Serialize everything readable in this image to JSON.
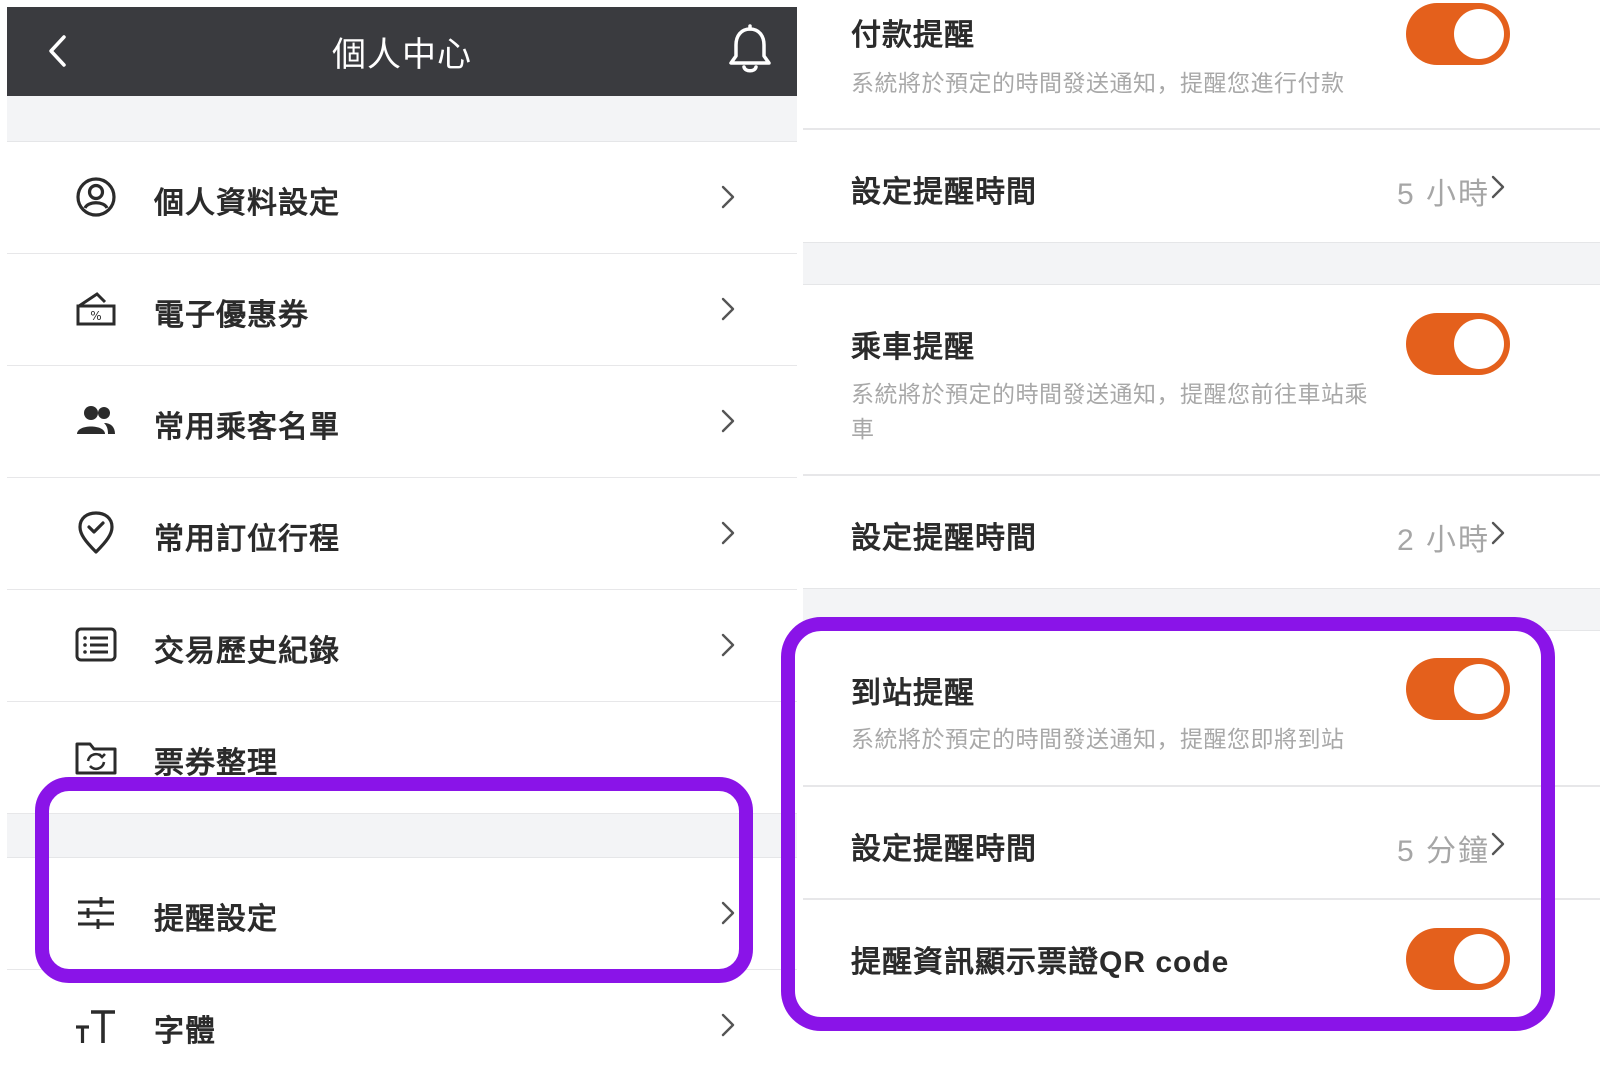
{
  "left_panel": {
    "header": {
      "title": "個人中心",
      "back_icon": "chevron-left-icon",
      "bell_icon": "bell-icon"
    },
    "menu_items": [
      {
        "label": "個人資料設定",
        "icon": "user-circle-icon"
      },
      {
        "label": "電子優惠券",
        "icon": "coupon-icon"
      },
      {
        "label": "常用乘客名單",
        "icon": "people-icon"
      },
      {
        "label": "常用訂位行程",
        "icon": "location-check-icon"
      },
      {
        "label": "交易歷史紀錄",
        "icon": "list-icon"
      },
      {
        "label": "票券整理",
        "icon": "folder-sync-icon"
      },
      {
        "label": "提醒設定",
        "icon": "sliders-icon"
      },
      {
        "label": "字體",
        "icon": "font-size-icon"
      }
    ]
  },
  "right_panel": {
    "payment_reminder": {
      "title": "付款提醒",
      "description": "系統將於預定的時間發送通知，提醒您進行付款",
      "enabled": true
    },
    "payment_time": {
      "label": "設定提醒時間",
      "value": "5 小時"
    },
    "boarding_reminder": {
      "title": "乘車提醒",
      "description": "系統將於預定的時間發送通知，提醒您前往車站乘車",
      "enabled": true
    },
    "boarding_time": {
      "label": "設定提醒時間",
      "value": "2 小時"
    },
    "arrival_reminder": {
      "title": "到站提醒",
      "description": "系統將於預定的時間發送通知，提醒您即將到站",
      "enabled": true
    },
    "arrival_time": {
      "label": "設定提醒時間",
      "value": "5 分鐘"
    },
    "qr_code_toggle": {
      "label": "提醒資訊顯示票證QR code",
      "enabled": true
    }
  },
  "colors": {
    "header_bg": "#3a3b3f",
    "toggle_on": "#e4601c",
    "highlight": "#8a14e8",
    "muted_text": "#a8a8a8"
  }
}
